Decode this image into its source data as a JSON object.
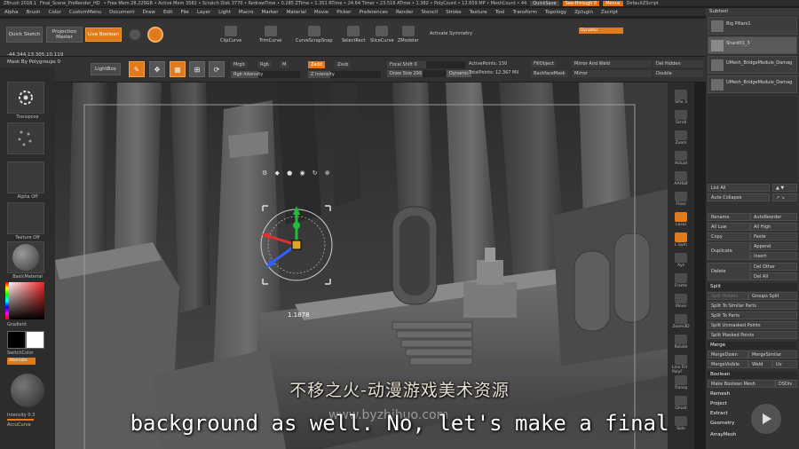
{
  "titlebar": {
    "app": "ZBrush 2018.1",
    "doc": "Final_Scene_PreRender_HD",
    "stats": "• Free Mem 28.229GB • Active Mem 3582 • Scratch Disk 3770 • RedrawTime • 0.285 ZTime • 1.351 RTime • 24.64 Timer • 23.516 ATime • 1.382 • PolyCount • 12.659 MP • MeshCount • 44",
    "quicksave": "QuickSave",
    "seethrough": "See-through 0",
    "menus_btn": "Menus",
    "script": "DefaultZScript"
  },
  "menubar": [
    "Alpha",
    "Brush",
    "Color",
    "CustomMenu",
    "Document",
    "Draw",
    "Edit",
    "File",
    "Layer",
    "Light",
    "Macro",
    "Marker",
    "Material",
    "Movie",
    "Picker",
    "Preferences",
    "Render",
    "Stencil",
    "Stroke",
    "Texture",
    "Tool",
    "Transform",
    "Topology",
    "Zplugin",
    "Zscript"
  ],
  "toolbar": {
    "quick_sketch": "Quick Sketch",
    "projection_master": "Projection Master",
    "live_boolean": "Live Boolean",
    "clipcurve": "ClipCurve",
    "trimcurve": "TrimCurve",
    "curvescrapsnap": "CurveScrapSnap",
    "selectrect": "SelectRect",
    "slicecurve": "SliceCurve",
    "zmodeler": "ZModeler",
    "activate_symmetry": "Activate Symmetry",
    "dynamic": "Dynamic"
  },
  "toolbar2": {
    "coords": "-44.344,13.305,10.119",
    "mask_by": "Mask By Polygroups 0",
    "lightbox": "LightBox",
    "edit": "Edit",
    "draw": "Draw",
    "move": "Move",
    "scale": "Scale",
    "rotate": "Rotate",
    "mrgb": "Mrgb",
    "rgb": "Rgb",
    "m": "M",
    "zadd": "Zadd",
    "zsub": "Zsub",
    "zcut": "Zcut",
    "rgb_intensity": "Rgb Intensity",
    "z_intensity": "Z Intensity",
    "focal_shift": "Focal Shift 0",
    "draw_size": "Draw Size 299",
    "dynamic2": "Dynamic",
    "active_points": "ActivePoints: 150",
    "total_points": "TotalPoints: 12.367 Mil",
    "fillobject": "FillObject",
    "backfacemask": "BackfaceMask",
    "mirror_weld": "Mirror And Weld",
    "mirror": "Mirror",
    "del_hidden": "Del Hidden",
    "double": "Double"
  },
  "leftshelf": {
    "transpose": "Transpose",
    "alpha_off": "Alpha Off",
    "texture_off": "Texture Off",
    "basic_material": "BasicMaterial",
    "gradient": "Gradient",
    "switch_color": "SwitchColor",
    "alternate": "Alternate",
    "intensity": "Intensity 0.3",
    "accucurve": "AccuCurve"
  },
  "viewport": {
    "gizmo_value": "1.1878"
  },
  "rightshelf": [
    "SPix 3",
    "Scroll",
    "Zoom",
    "Actual",
    "AAHalf",
    "Floor",
    "Local",
    "L.Sym",
    "Xyz",
    "Frame",
    "Move",
    "Zoom3D",
    "Rotate",
    "Line Fill PolyF",
    "Transp",
    "Ghost",
    "Solo"
  ],
  "subtool": {
    "title": "Subtool",
    "items": [
      "Big Pillars1",
      "Shard01_3",
      "UMesh_BridgeModule_Damag",
      "UMesh_BridgeModule_Damag"
    ],
    "list_all": "List All",
    "auto_collapse": "Auto Collapse",
    "rename": "Rename",
    "autoreorder": "AutoReorder",
    "all_low": "All Low",
    "all_high": "All High",
    "copy": "Copy",
    "paste": "Paste",
    "duplicate": "Duplicate",
    "append": "Append",
    "insert": "Insert",
    "delete": "Delete",
    "del_other": "Del Other",
    "del_all": "Del All",
    "split_section": "Split",
    "split_hidden": "Split Hidden",
    "groups_split": "Groups Split",
    "split_similar": "Split To Similar Parts",
    "split_parts": "Split To Parts",
    "split_unmasked": "Split Unmasked Points",
    "split_masked": "Split Masked Points",
    "merge_section": "Merge",
    "mergedown": "MergeDown",
    "mergesimilar": "MergeSimilar",
    "mergevisible": "MergeVisible",
    "weld": "Weld",
    "uv": "Uv",
    "boolean_section": "Boolean",
    "make_boolean": "Make Boolean Mesh",
    "dsdiv": "DSDiv",
    "remesh": "Remesh",
    "project": "Project",
    "extract": "Extract",
    "geometry": "Geometry",
    "arraymesh": "ArrayMesh"
  },
  "subtitles": {
    "chinese": "不移之火-动漫游戏美术资源",
    "english": "background as well. No, let's make a final",
    "url": "www.byzhihuo.com"
  }
}
